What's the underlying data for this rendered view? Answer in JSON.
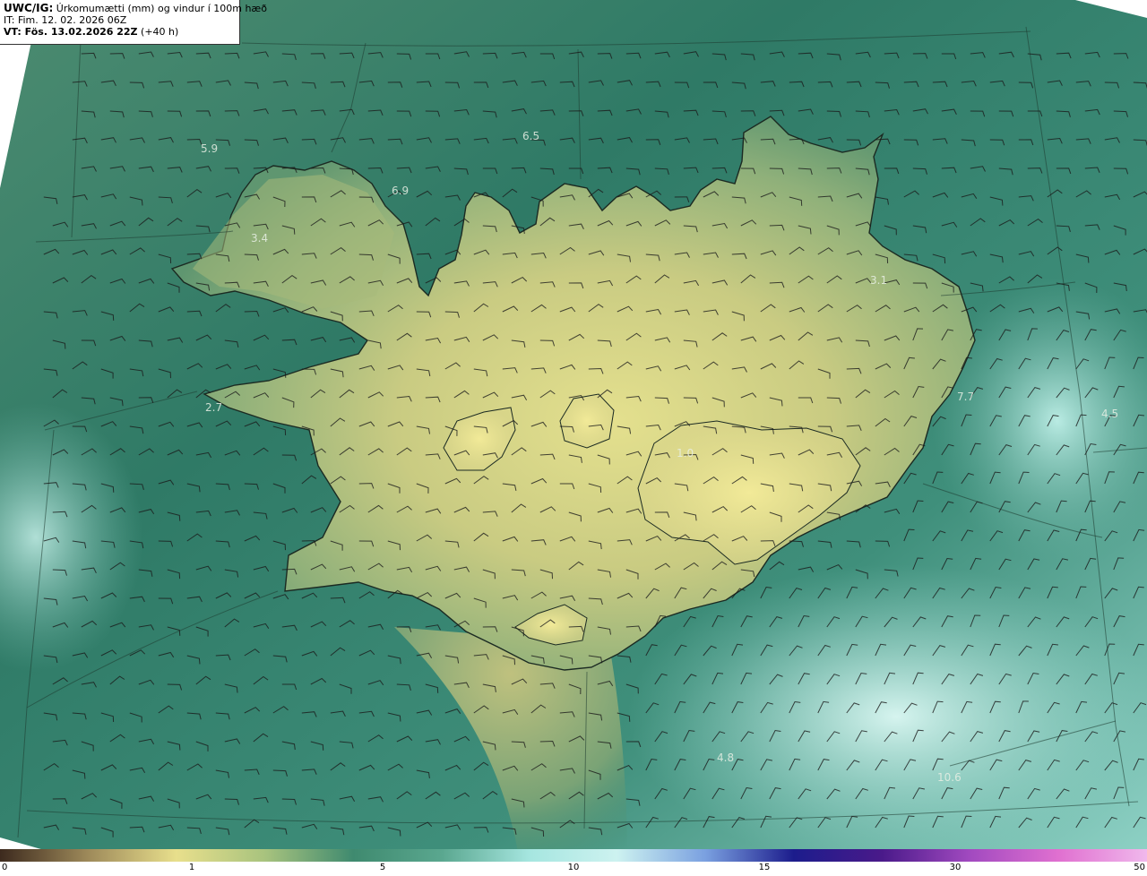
{
  "header": {
    "title_prefix": "UWC/IG:",
    "title_text": "Úrkomumætti (mm) og vindur í 100m hæð",
    "init_time": "IT: Fim. 12. 02. 2026 06Z",
    "valid_prefix": "VT: Fös. 13.02.2026 22Z",
    "valid_suffix": "(+40 h)"
  },
  "map_labels": [
    "5.9",
    "6.5",
    "6.9",
    "3.4",
    "3.1",
    "2.7",
    "7.7",
    "4.5",
    "1.0",
    "4.8",
    "10.6"
  ],
  "colorbar": {
    "ticks": [
      "0",
      "1",
      "5",
      "10",
      "15",
      "30",
      "50"
    ],
    "colors": [
      "#3d2a1e",
      "#9e8a5a",
      "#e8df8c",
      "#a8c37e",
      "#3f8a6f",
      "#5aa78f",
      "#a6e6e0",
      "#cdf2f0",
      "#7aa0e0",
      "#1c1c8c",
      "#4a1a8a",
      "#a24ac0",
      "#e070d0",
      "#f0b8ec"
    ]
  },
  "colors": {
    "sea_mid": "#2f7a66",
    "sea_light": "#6ab2a2",
    "land_low": "#79a574",
    "land_high": "#e4e08e"
  }
}
